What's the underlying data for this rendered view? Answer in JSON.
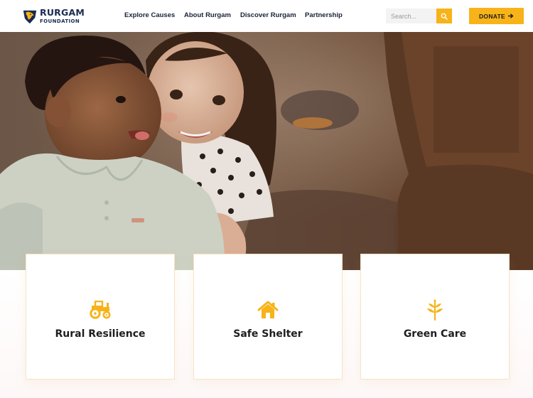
{
  "brand": {
    "name_line1": "RURGAM",
    "name_line2": "FOUNDATION",
    "accent_color": "#f7b319",
    "navy_color": "#1a2a52"
  },
  "nav": {
    "items": [
      {
        "label": "Explore Causes"
      },
      {
        "label": "About Rurgam"
      },
      {
        "label": "Discover Rurgam"
      },
      {
        "label": "Partnership"
      }
    ]
  },
  "search": {
    "placeholder": "Search...",
    "value": "",
    "icon": "search-icon"
  },
  "donate": {
    "label": "DONATE",
    "icon": "arrow-right-icon"
  },
  "hero": {
    "image": "two smiling children hugging"
  },
  "cards": [
    {
      "title": "Rural Resilience",
      "icon": "tractor-icon"
    },
    {
      "title": "Safe Shelter",
      "icon": "house-icon"
    },
    {
      "title": "Green Care",
      "icon": "leaf-branch-icon"
    }
  ]
}
